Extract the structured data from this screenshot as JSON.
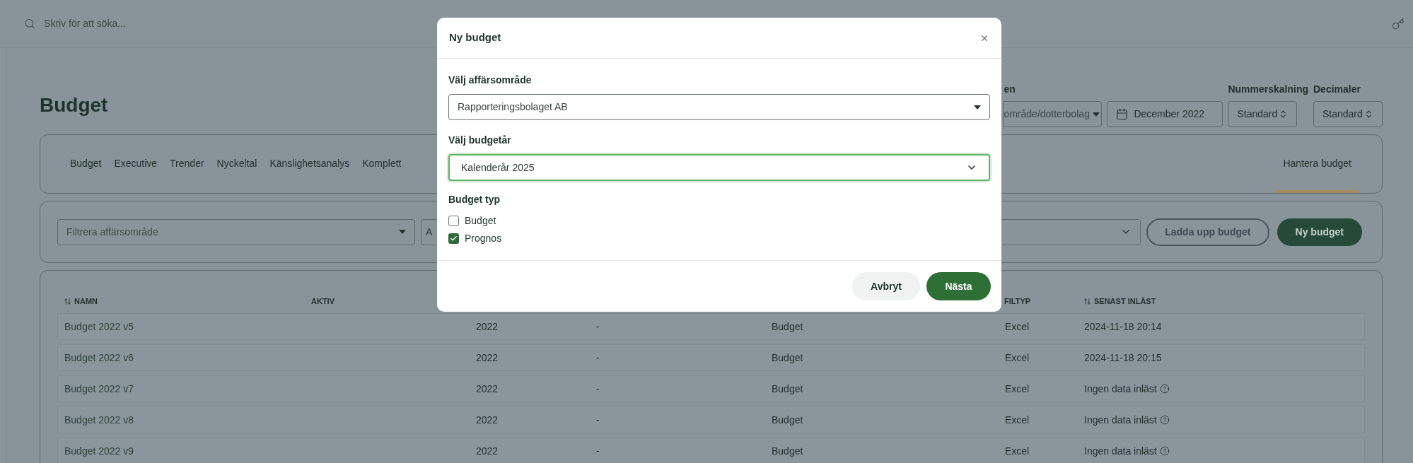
{
  "search": {
    "placeholder": "Skriv för att söka..."
  },
  "page": {
    "title": "Budget"
  },
  "header_controls": {
    "company_label": "en",
    "company_value": "område/dotterbolag",
    "period": "December 2022",
    "scaling": {
      "label": "Nummerskalning",
      "value": "Standard"
    },
    "decimals": {
      "label": "Decimaler",
      "value": "Standard"
    }
  },
  "tabs": [
    {
      "label": "Budget",
      "selected": false
    },
    {
      "label": "Executive",
      "selected": false
    },
    {
      "label": "Trender",
      "selected": false
    },
    {
      "label": "Nyckeltal",
      "selected": false
    },
    {
      "label": "Känslighetsanalys",
      "selected": false
    },
    {
      "label": "Komplett",
      "selected": false
    },
    {
      "label": "Hantera budget",
      "selected": true
    }
  ],
  "filters": {
    "business_area": {
      "placeholder": "Filtrera affärsområde"
    },
    "column_2": {
      "placeholder": "A"
    },
    "upload_button": "Ladda upp budget",
    "new_button": "Ny budget"
  },
  "table": {
    "columns": [
      {
        "label": "NAMN",
        "sortable": true
      },
      {
        "label": "AKTIV",
        "sortable": false
      },
      {},
      {},
      {},
      {
        "label": "FILTYP",
        "sortable": false
      },
      {
        "label": "SENAST INLÄST",
        "sortable": true
      }
    ],
    "rows": [
      {
        "name": "Budget 2022 v5",
        "year": "2022",
        "column_4": "-",
        "type": "Budget",
        "file_type": "Excel",
        "last_loaded": "2024-11-18 20:14",
        "help": false
      },
      {
        "name": "Budget 2022 v6",
        "year": "2022",
        "column_4": "-",
        "type": "Budget",
        "file_type": "Excel",
        "last_loaded": "2024-11-18 20:15",
        "help": false
      },
      {
        "name": "Budget 2022 v7",
        "year": "2022",
        "column_4": "-",
        "type": "Budget",
        "file_type": "Excel",
        "last_loaded": "Ingen data inläst",
        "help": true
      },
      {
        "name": "Budget 2022 v8",
        "year": "2022",
        "column_4": "-",
        "type": "Budget",
        "file_type": "Excel",
        "last_loaded": "Ingen data inläst",
        "help": true
      },
      {
        "name": "Budget 2022 v9",
        "year": "2022",
        "column_4": "-",
        "type": "Budget",
        "file_type": "Excel",
        "last_loaded": "Ingen data inläst",
        "help": true
      }
    ]
  },
  "dialog": {
    "title": "Ny budget",
    "business_area": {
      "label": "Välj affärsområde",
      "value": "Rapporteringsbolaget AB"
    },
    "budget_year": {
      "label": "Välj budgetår",
      "value": "Kalenderår 2025",
      "focused": true
    },
    "budget_type": {
      "label": "Budget typ",
      "options": [
        {
          "label": "Budget",
          "checked": false
        },
        {
          "label": "Prognos",
          "checked": true
        }
      ]
    },
    "buttons": {
      "cancel": "Avbryt",
      "next": "Nästa"
    }
  }
}
